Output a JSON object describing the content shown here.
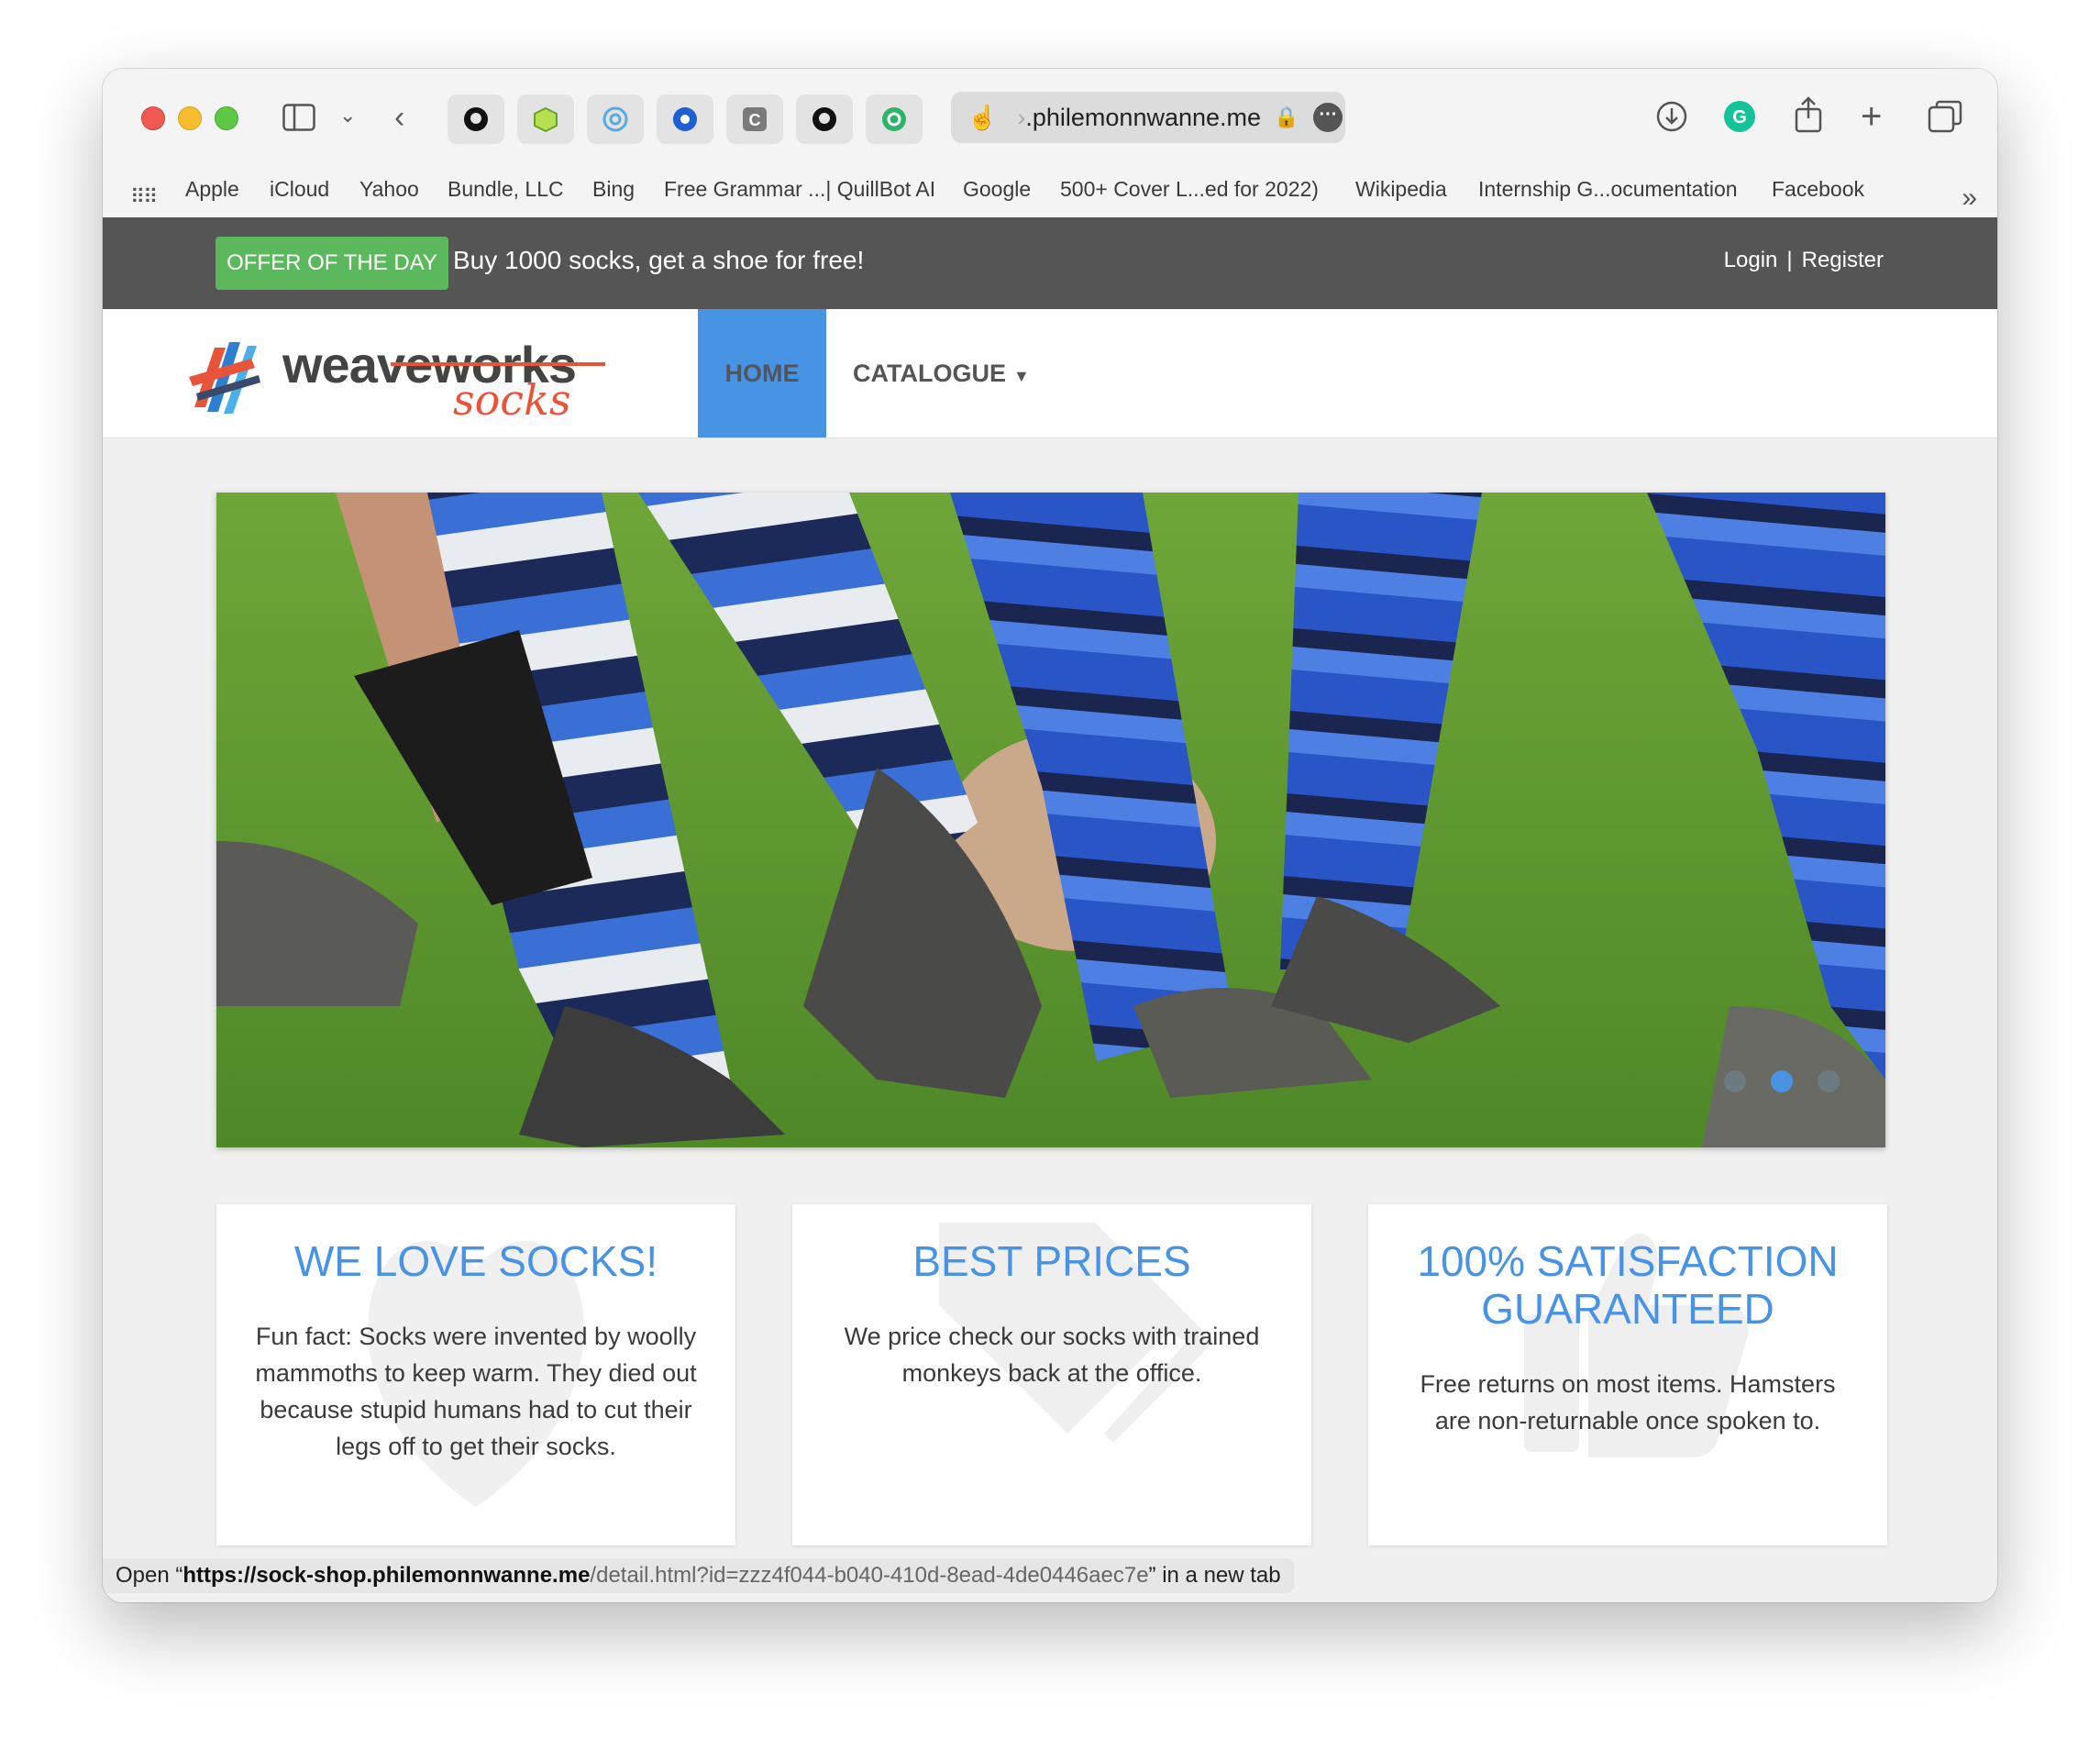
{
  "browser": {
    "url_prefix": "",
    "url_domain": ".philemonnwanne.me",
    "bookmarks": [
      "Apple",
      "iCloud",
      "Yahoo",
      "Bundle, LLC",
      "Bing",
      "Free Grammar ...| QuillBot AI",
      "Google",
      "500+ Cover L...ed for 2022)",
      "Wikipedia",
      "Internship G...ocumentation",
      "Facebook"
    ],
    "status_open": "Open “",
    "status_url_bold": "https://sock-shop.philemonnwanne.me",
    "status_url_rest": "/detail.html?id=zzz4f044-b040-410d-8ead-4de0446aec7e",
    "status_suffix": "” in a new tab"
  },
  "topbar": {
    "offer_badge": "OFFER OF THE DAY",
    "offer_text": "Buy 1000 socks, get a shoe for free!",
    "login": "Login",
    "separator": "|",
    "register": "Register"
  },
  "logo": {
    "word": "weaveworks",
    "socks": "socks"
  },
  "nav": {
    "home": "HOME",
    "catalogue": "CATALOGUE"
  },
  "carousel": {
    "active_slide": 2,
    "slide_count": 3
  },
  "features": [
    {
      "title": "WE LOVE SOCKS!",
      "text": "Fun fact: Socks were invented by woolly mammoths to keep warm. They died out because stupid humans had to cut their legs off to get their socks.",
      "icon": "heart-icon"
    },
    {
      "title": "BEST PRICES",
      "text": "We price check our socks with trained monkeys back at the office.",
      "icon": "tags-icon"
    },
    {
      "title": "100% SATISFACTION GUARANTEED",
      "text": "Free returns on most items. Hamsters are non-returnable once spoken to.",
      "icon": "thumbs-up-icon"
    }
  ],
  "colors": {
    "accent": "#4993e4",
    "offer_green": "#5cb85c",
    "topbar": "#555555",
    "brand_orange": "#e8543a"
  }
}
